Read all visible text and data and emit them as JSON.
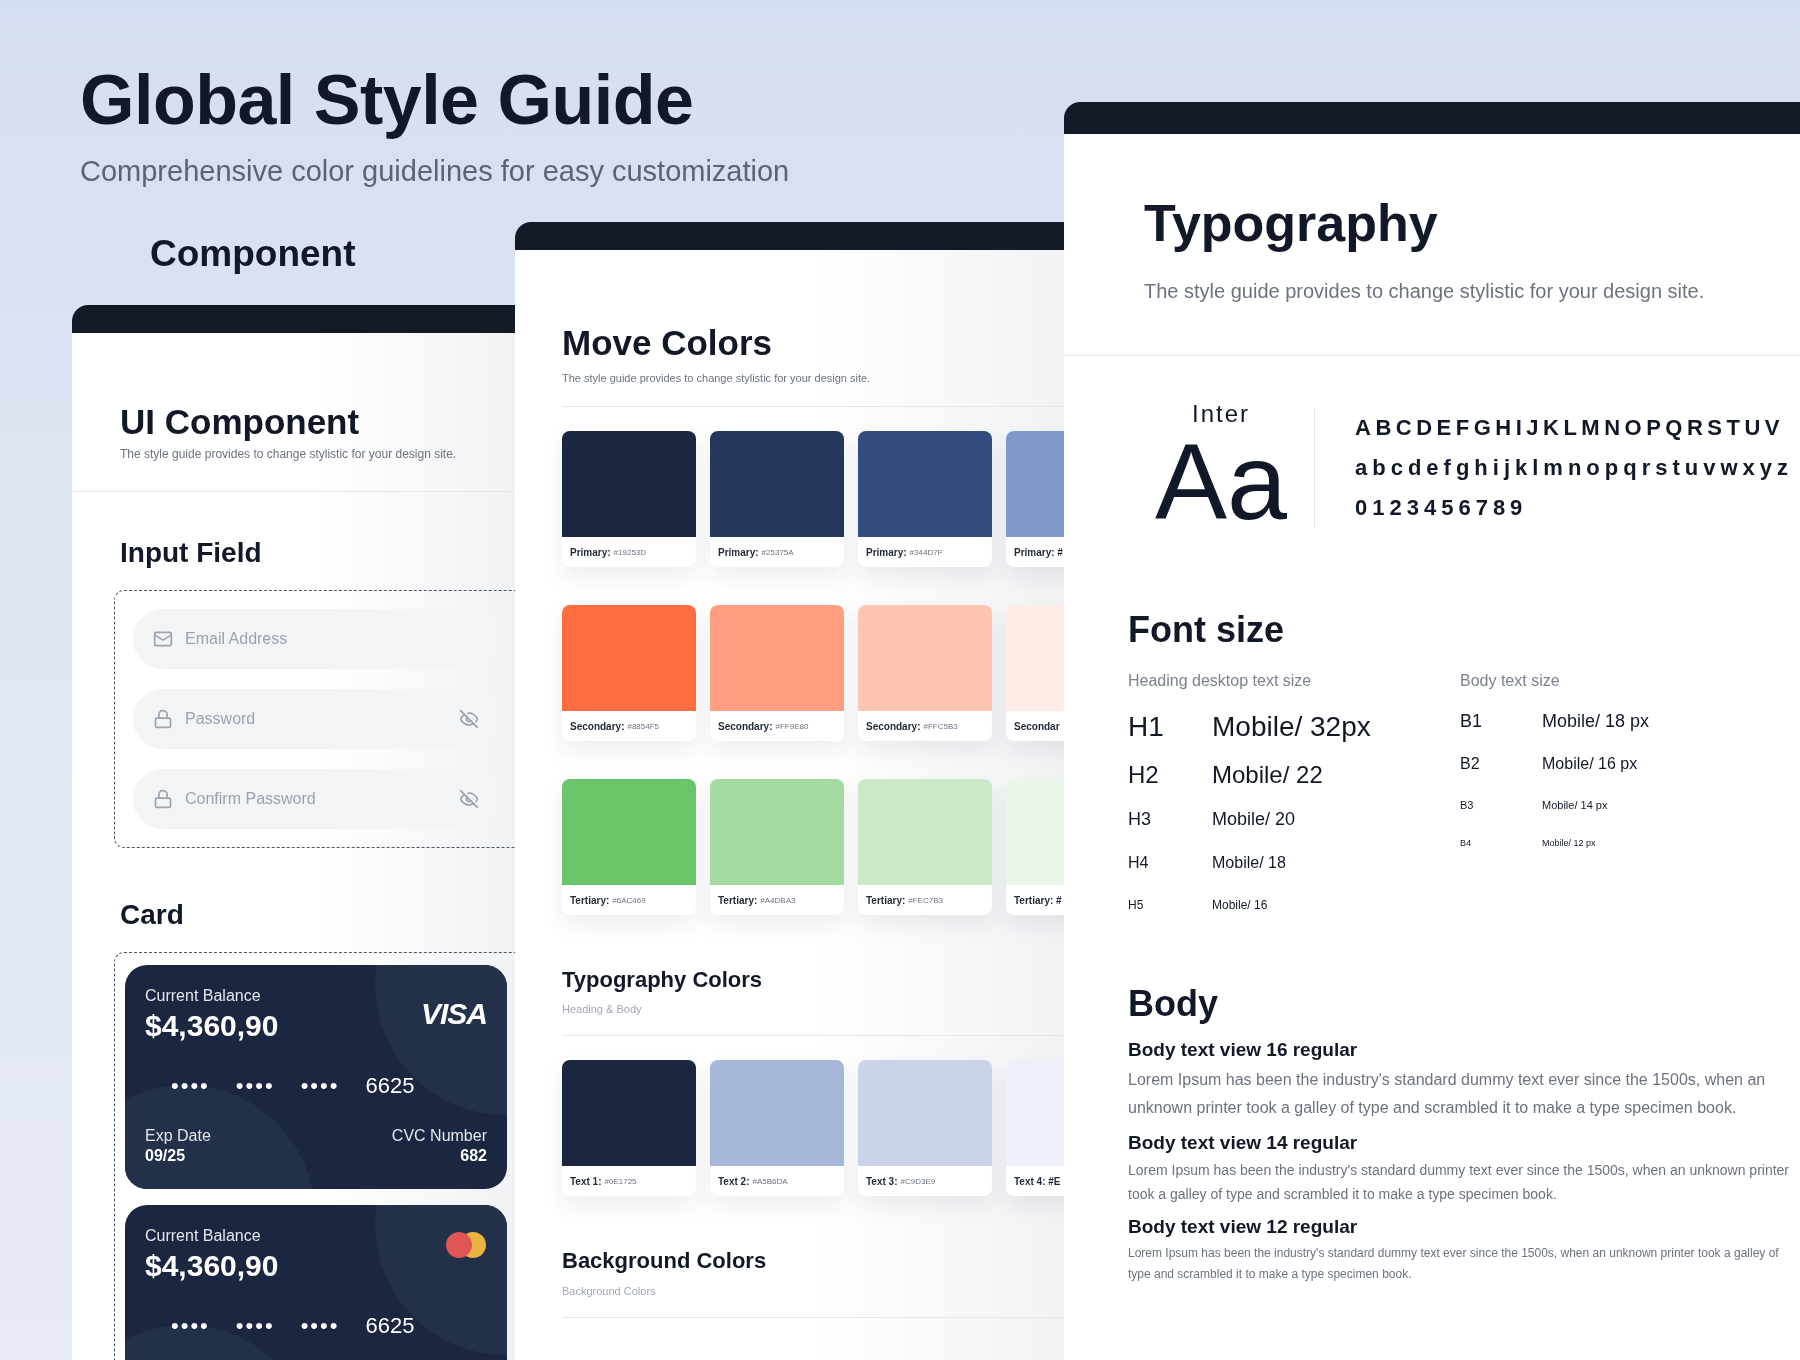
{
  "header": {
    "title": "Global Style Guide",
    "subtitle": "Comprehensive color guidelines for easy customization",
    "section_label": "Component"
  },
  "component_panel": {
    "title": "UI Component",
    "subtitle": "The style guide provides to change stylistic for your design site.",
    "input_heading": "Input Field",
    "inputs": [
      {
        "placeholder": "Email Address",
        "kind": "email"
      },
      {
        "placeholder": "Password",
        "kind": "password"
      },
      {
        "placeholder": "Confirm Password",
        "kind": "password"
      }
    ],
    "card_heading": "Card",
    "cards": [
      {
        "balance_label": "Current Balance",
        "balance": "$4,360,90",
        "kind": "visa",
        "brand_text": "VISA",
        "groups": [
          "••••",
          "••••",
          "••••"
        ],
        "last4": "6625",
        "exp_label": "Exp Date",
        "exp": "09/25",
        "cvc_label": "CVC Number",
        "cvc": "682"
      },
      {
        "balance_label": "Current Balance",
        "balance": "$4,360,90",
        "kind": "mastercard",
        "groups": [
          "••••",
          "••••",
          "••••"
        ],
        "last4": "6625"
      }
    ]
  },
  "colors_panel": {
    "title": "Move Colors",
    "subtitle": "The style guide provides to change stylistic for your design site.",
    "palettes": [
      {
        "swatches": [
          {
            "name": "Primary:",
            "hex": "#19253D",
            "color": "#1b2640"
          },
          {
            "name": "Primary:",
            "hex": "#25375A",
            "color": "#25375a"
          },
          {
            "name": "Primary:",
            "hex": "#344D7F",
            "color": "#344d7f"
          },
          {
            "name": "Primary: #",
            "color": "#7f9aca"
          }
        ]
      },
      {
        "swatches": [
          {
            "name": "Secondary:",
            "hex": "#8854F5",
            "color": "#ff6d40"
          },
          {
            "name": "Secondary:",
            "hex": "#FF9E80",
            "color": "#ff9e80"
          },
          {
            "name": "Secondary:",
            "hex": "#FFC5B3",
            "color": "#ffc5b3"
          },
          {
            "name": "Secondar",
            "color": "#ffece6"
          }
        ]
      },
      {
        "swatches": [
          {
            "name": "Tertiary:",
            "hex": "#6AC469",
            "color": "#6ac469"
          },
          {
            "name": "Tertiary:",
            "hex": "#A4DBA3",
            "color": "#a4dba3"
          },
          {
            "name": "Tertiary:",
            "hex": "#FEC7B3",
            "color": "#c9e9c8"
          },
          {
            "name": "Tertiary: #",
            "color": "#ebf6ea"
          }
        ]
      }
    ],
    "sections": [
      {
        "title": "Typography Colors",
        "subtitle": "Heading & Body",
        "swatches": [
          {
            "name": "Text 1:",
            "hex": "#0E1725",
            "color": "#1b2640"
          },
          {
            "name": "Text 2:",
            "hex": "#A5B6DA",
            "color": "#a7b7da"
          },
          {
            "name": "Text 3:",
            "hex": "#C9D3E9",
            "color": "#c9d3e9"
          },
          {
            "name": "Text 4: #E",
            "color": "#edf0f8"
          }
        ]
      },
      {
        "title": "Background Colors",
        "subtitle": "Background Colors"
      }
    ]
  },
  "typography_panel": {
    "title": "Typography",
    "subtitle": "The style guide provides to change stylistic for your design site.",
    "font_name": "Inter",
    "sample": "Aa",
    "glyph_rows": [
      "ABCDEFGHIJKLMNOPQRSTUV",
      "abcdefghijklmnopqrstuvwxyz",
      "0123456789"
    ],
    "font_size": {
      "title": "Font size",
      "heading_label": "Heading desktop text size",
      "body_label": "Body text size",
      "headings": [
        {
          "tag": "H1",
          "value": "Mobile/ 32px"
        },
        {
          "tag": "H2",
          "value": "Mobile/ 22"
        },
        {
          "tag": "H3",
          "value": "Mobile/ 20"
        },
        {
          "tag": "H4",
          "value": "Mobile/ 18"
        },
        {
          "tag": "H5",
          "value": "Mobile/ 16"
        }
      ],
      "body_sizes": [
        {
          "tag": "B1",
          "value": "Mobile/ 18 px"
        },
        {
          "tag": "B2",
          "value": "Mobile/ 16 px"
        },
        {
          "tag": "B3",
          "value": "Mobile/ 14 px"
        },
        {
          "tag": "B4",
          "value": "Mobile/ 12 px"
        }
      ]
    },
    "body": {
      "title": "Body",
      "samples": [
        {
          "title": "Body text view 16 regular",
          "text": "Lorem Ipsum has been the industry's standard dummy text ever since the 1500s, when an unknown printer took a galley of  type and scrambled it to make a type specimen book."
        },
        {
          "title": "Body text view 14 regular",
          "text": "Lorem Ipsum has been the industry's standard dummy text ever since the 1500s, when an unknown printer took a galley of  type and scrambled it to make a type specimen book."
        },
        {
          "title": "Body text view 12 regular",
          "text": "Lorem Ipsum has been the industry's standard dummy text ever since the 1500s, when an unknown printer took a galley of  type and scrambled it to make a type specimen book."
        }
      ]
    }
  }
}
